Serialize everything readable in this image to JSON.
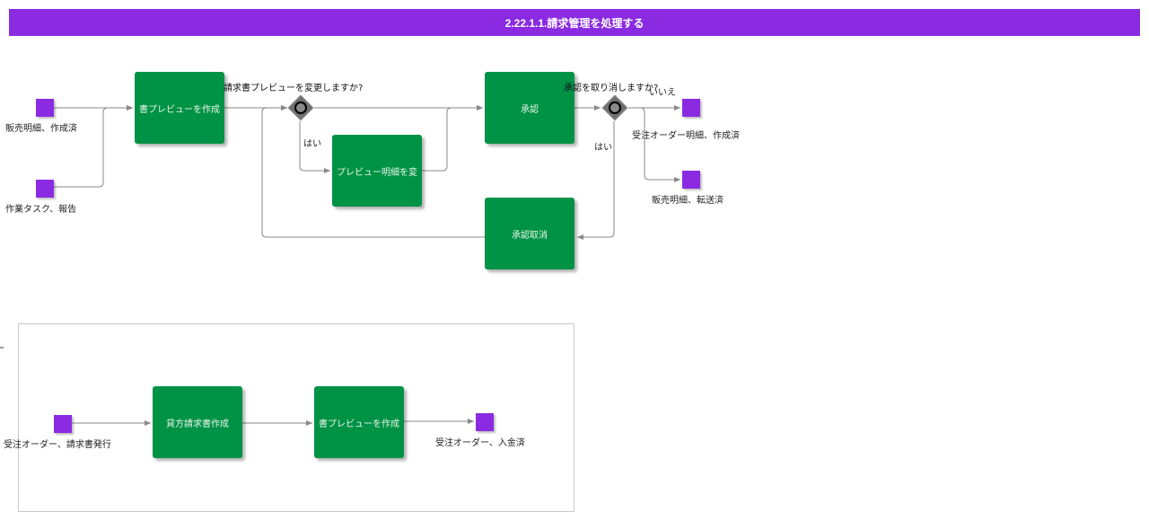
{
  "title": "2.22.1.1.請求管理を処理する",
  "colors": {
    "title_bar": "#8a2be2",
    "task": "#009245",
    "event": "#8a2be2",
    "gateway": "#707070",
    "edge": "#888888"
  },
  "events": {
    "sales_created": "販売明細、作成済",
    "work_task_reported": "作業タスク、報告",
    "order_line_created": "受注オーダー明細、作成済",
    "sales_transferred": "販売明細、転送済",
    "order_invoice_issued": "受注オーダー、請求書発行",
    "order_paid": "受注オーダー、入金済"
  },
  "tasks": {
    "create_preview": "書プレビューを作成",
    "change_preview_lines": "プレビュー明細を変",
    "approve": "承認",
    "cancel_approval": "承認取消",
    "credit_invoice": "貸方請求書作成",
    "create_preview_2": "書プレビューを作成"
  },
  "gateways": {
    "change_question": "請求書プレビューを変更しますか?",
    "cancel_question": "承認を取り消しますか?"
  },
  "edge_labels": {
    "yes_1": "はい",
    "no": "いいえ",
    "yes_2": "はい"
  },
  "icons": {
    "gateway": "gateway-diamond-icon"
  }
}
